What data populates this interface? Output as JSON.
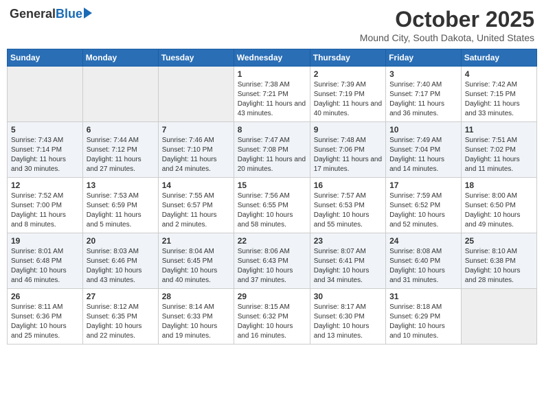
{
  "header": {
    "logo_general": "General",
    "logo_blue": "Blue",
    "month_title": "October 2025",
    "location": "Mound City, South Dakota, United States"
  },
  "days_of_week": [
    "Sunday",
    "Monday",
    "Tuesday",
    "Wednesday",
    "Thursday",
    "Friday",
    "Saturday"
  ],
  "weeks": [
    [
      {
        "day": "",
        "empty": true
      },
      {
        "day": "",
        "empty": true
      },
      {
        "day": "",
        "empty": true
      },
      {
        "day": "1",
        "sunrise": "Sunrise: 7:38 AM",
        "sunset": "Sunset: 7:21 PM",
        "daylight": "Daylight: 11 hours and 43 minutes."
      },
      {
        "day": "2",
        "sunrise": "Sunrise: 7:39 AM",
        "sunset": "Sunset: 7:19 PM",
        "daylight": "Daylight: 11 hours and 40 minutes."
      },
      {
        "day": "3",
        "sunrise": "Sunrise: 7:40 AM",
        "sunset": "Sunset: 7:17 PM",
        "daylight": "Daylight: 11 hours and 36 minutes."
      },
      {
        "day": "4",
        "sunrise": "Sunrise: 7:42 AM",
        "sunset": "Sunset: 7:15 PM",
        "daylight": "Daylight: 11 hours and 33 minutes."
      }
    ],
    [
      {
        "day": "5",
        "sunrise": "Sunrise: 7:43 AM",
        "sunset": "Sunset: 7:14 PM",
        "daylight": "Daylight: 11 hours and 30 minutes."
      },
      {
        "day": "6",
        "sunrise": "Sunrise: 7:44 AM",
        "sunset": "Sunset: 7:12 PM",
        "daylight": "Daylight: 11 hours and 27 minutes."
      },
      {
        "day": "7",
        "sunrise": "Sunrise: 7:46 AM",
        "sunset": "Sunset: 7:10 PM",
        "daylight": "Daylight: 11 hours and 24 minutes."
      },
      {
        "day": "8",
        "sunrise": "Sunrise: 7:47 AM",
        "sunset": "Sunset: 7:08 PM",
        "daylight": "Daylight: 11 hours and 20 minutes."
      },
      {
        "day": "9",
        "sunrise": "Sunrise: 7:48 AM",
        "sunset": "Sunset: 7:06 PM",
        "daylight": "Daylight: 11 hours and 17 minutes."
      },
      {
        "day": "10",
        "sunrise": "Sunrise: 7:49 AM",
        "sunset": "Sunset: 7:04 PM",
        "daylight": "Daylight: 11 hours and 14 minutes."
      },
      {
        "day": "11",
        "sunrise": "Sunrise: 7:51 AM",
        "sunset": "Sunset: 7:02 PM",
        "daylight": "Daylight: 11 hours and 11 minutes."
      }
    ],
    [
      {
        "day": "12",
        "sunrise": "Sunrise: 7:52 AM",
        "sunset": "Sunset: 7:00 PM",
        "daylight": "Daylight: 11 hours and 8 minutes."
      },
      {
        "day": "13",
        "sunrise": "Sunrise: 7:53 AM",
        "sunset": "Sunset: 6:59 PM",
        "daylight": "Daylight: 11 hours and 5 minutes."
      },
      {
        "day": "14",
        "sunrise": "Sunrise: 7:55 AM",
        "sunset": "Sunset: 6:57 PM",
        "daylight": "Daylight: 11 hours and 2 minutes."
      },
      {
        "day": "15",
        "sunrise": "Sunrise: 7:56 AM",
        "sunset": "Sunset: 6:55 PM",
        "daylight": "Daylight: 10 hours and 58 minutes."
      },
      {
        "day": "16",
        "sunrise": "Sunrise: 7:57 AM",
        "sunset": "Sunset: 6:53 PM",
        "daylight": "Daylight: 10 hours and 55 minutes."
      },
      {
        "day": "17",
        "sunrise": "Sunrise: 7:59 AM",
        "sunset": "Sunset: 6:52 PM",
        "daylight": "Daylight: 10 hours and 52 minutes."
      },
      {
        "day": "18",
        "sunrise": "Sunrise: 8:00 AM",
        "sunset": "Sunset: 6:50 PM",
        "daylight": "Daylight: 10 hours and 49 minutes."
      }
    ],
    [
      {
        "day": "19",
        "sunrise": "Sunrise: 8:01 AM",
        "sunset": "Sunset: 6:48 PM",
        "daylight": "Daylight: 10 hours and 46 minutes."
      },
      {
        "day": "20",
        "sunrise": "Sunrise: 8:03 AM",
        "sunset": "Sunset: 6:46 PM",
        "daylight": "Daylight: 10 hours and 43 minutes."
      },
      {
        "day": "21",
        "sunrise": "Sunrise: 8:04 AM",
        "sunset": "Sunset: 6:45 PM",
        "daylight": "Daylight: 10 hours and 40 minutes."
      },
      {
        "day": "22",
        "sunrise": "Sunrise: 8:06 AM",
        "sunset": "Sunset: 6:43 PM",
        "daylight": "Daylight: 10 hours and 37 minutes."
      },
      {
        "day": "23",
        "sunrise": "Sunrise: 8:07 AM",
        "sunset": "Sunset: 6:41 PM",
        "daylight": "Daylight: 10 hours and 34 minutes."
      },
      {
        "day": "24",
        "sunrise": "Sunrise: 8:08 AM",
        "sunset": "Sunset: 6:40 PM",
        "daylight": "Daylight: 10 hours and 31 minutes."
      },
      {
        "day": "25",
        "sunrise": "Sunrise: 8:10 AM",
        "sunset": "Sunset: 6:38 PM",
        "daylight": "Daylight: 10 hours and 28 minutes."
      }
    ],
    [
      {
        "day": "26",
        "sunrise": "Sunrise: 8:11 AM",
        "sunset": "Sunset: 6:36 PM",
        "daylight": "Daylight: 10 hours and 25 minutes."
      },
      {
        "day": "27",
        "sunrise": "Sunrise: 8:12 AM",
        "sunset": "Sunset: 6:35 PM",
        "daylight": "Daylight: 10 hours and 22 minutes."
      },
      {
        "day": "28",
        "sunrise": "Sunrise: 8:14 AM",
        "sunset": "Sunset: 6:33 PM",
        "daylight": "Daylight: 10 hours and 19 minutes."
      },
      {
        "day": "29",
        "sunrise": "Sunrise: 8:15 AM",
        "sunset": "Sunset: 6:32 PM",
        "daylight": "Daylight: 10 hours and 16 minutes."
      },
      {
        "day": "30",
        "sunrise": "Sunrise: 8:17 AM",
        "sunset": "Sunset: 6:30 PM",
        "daylight": "Daylight: 10 hours and 13 minutes."
      },
      {
        "day": "31",
        "sunrise": "Sunrise: 8:18 AM",
        "sunset": "Sunset: 6:29 PM",
        "daylight": "Daylight: 10 hours and 10 minutes."
      },
      {
        "day": "",
        "empty": true
      }
    ]
  ]
}
